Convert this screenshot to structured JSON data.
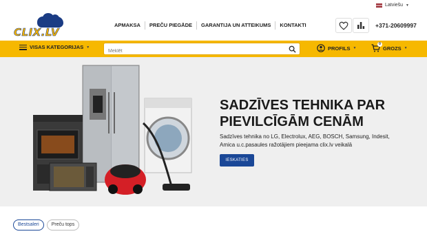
{
  "topbar": {
    "language": "Latviešu",
    "language_icon": "latvia-flag-icon"
  },
  "header": {
    "logo_text": "CLIX.LV",
    "nav": [
      "APMAKSA",
      "PREČU PIEGĀDE",
      "GARANTIJA UN ATTEIKUMS",
      "KONTAKTI"
    ],
    "wishlist_icon": "heart-icon",
    "compare_icon": "bar-chart-icon",
    "phone": "+371-20609997"
  },
  "toolbar": {
    "categories_label": "VISAS KATEGORIJAS",
    "search_placeholder": "Meklēt",
    "search_icon": "magnifier-icon",
    "profile_label": "PROFILS",
    "cart_label": "GROZS",
    "cart_count": "0",
    "accent_color": "#f6b800"
  },
  "banner": {
    "title": "SADZĪVES TEHNIKA PAR PIEVILCĪGĀM CENĀM",
    "text": "Sadzīves tehnika no LG, Electrolux, AEG, BOSCH, Samsung, Indesit, Amica u.c.pasaules ražotājiem pieejama clix.lv veikalā",
    "cta_label": "IESKATIES",
    "cta_color": "#1a4797"
  },
  "tabs": [
    {
      "label": "Bestsaleri",
      "active": true
    },
    {
      "label": "Preču tops",
      "active": false
    }
  ]
}
